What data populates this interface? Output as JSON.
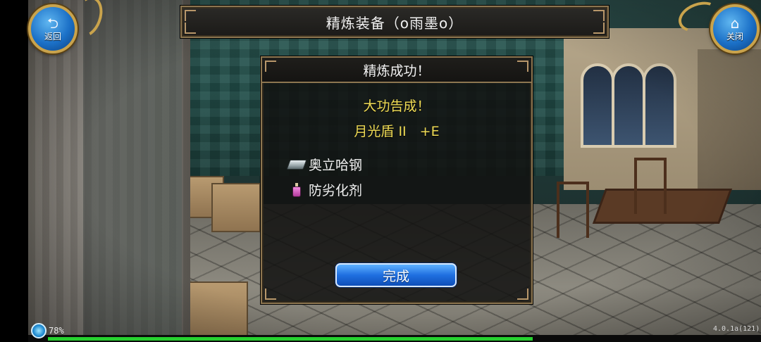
{
  "top_bar": {
    "back_label": "返回",
    "close_label": "关闭",
    "title": "精炼装备（o雨墨o）"
  },
  "result_dialog": {
    "title": "精炼成功！",
    "headline": "大功告成！",
    "item_result": "月光盾 II　+E",
    "materials": [
      {
        "name": "奥立哈钢",
        "icon": "ingot-icon"
      },
      {
        "name": "防劣化剂",
        "icon": "potion-icon"
      }
    ],
    "confirm_label": "完成"
  },
  "status": {
    "battery": "78%",
    "version": "4.0.1a(121)",
    "exp_progress": 0.73
  },
  "colors": {
    "accent_gold": "#8d7650",
    "headline_yellow": "#f0dc55",
    "button_blue": "#1f6fe0",
    "exp_green": "#27d12f"
  }
}
